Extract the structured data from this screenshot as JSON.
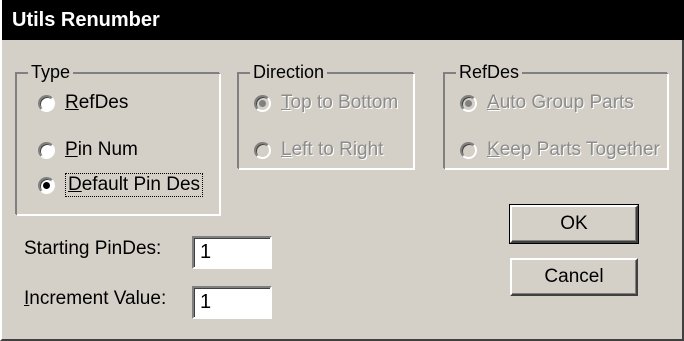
{
  "window": {
    "title": "Utils Renumber"
  },
  "type_group": {
    "legend": "Type",
    "options": [
      {
        "label_u": "R",
        "label_rest": "efDes",
        "checked": false
      },
      {
        "label_u": "P",
        "label_rest": "in Num",
        "checked": false
      },
      {
        "label_u": "D",
        "label_rest": "efault Pin Des",
        "checked": true
      }
    ]
  },
  "direction_group": {
    "legend": "Direction",
    "options": [
      {
        "label_u": "T",
        "label_rest": "op to Bottom",
        "checked": true,
        "disabled": true
      },
      {
        "label_u": "L",
        "label_rest": "eft to Right",
        "checked": false,
        "disabled": true
      }
    ]
  },
  "refdes_group": {
    "legend": "RefDes",
    "options": [
      {
        "label_u": "A",
        "label_rest": "uto Group Parts",
        "checked": true,
        "disabled": true
      },
      {
        "label_u": "K",
        "label_rest": "eep Parts Together",
        "checked": false,
        "disabled": true
      }
    ]
  },
  "fields": {
    "starting_label": "Starting PinDes:",
    "starting_value": "1",
    "increment_label_u": "I",
    "increment_label_rest": "ncrement Value:",
    "increment_value": "1"
  },
  "buttons": {
    "ok": "OK",
    "cancel": "Cancel"
  }
}
